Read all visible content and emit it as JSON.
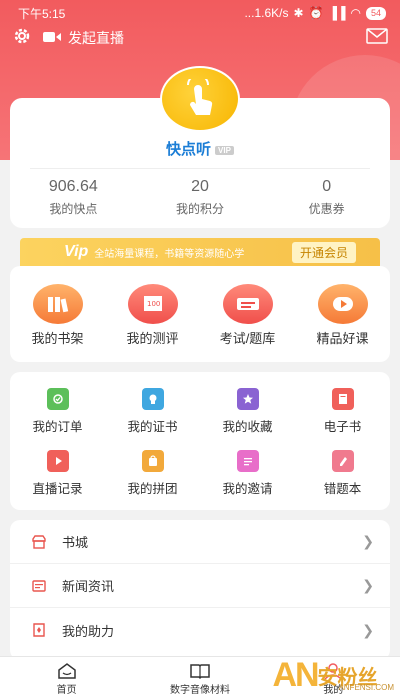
{
  "status_bar": {
    "time": "下午5:15",
    "network": "...1.6K/s",
    "battery": "54"
  },
  "top_bar": {
    "live_label": "发起直播"
  },
  "profile": {
    "username": "快点听",
    "vip_badge": "VIP",
    "stats": [
      {
        "value": "906.64",
        "label": "我的快点"
      },
      {
        "value": "20",
        "label": "我的积分"
      },
      {
        "value": "0",
        "label": "优惠券"
      }
    ]
  },
  "vip_banner": {
    "vip_word": "Vip",
    "description": "全站海量课程，书籍等资源随心学",
    "button": "开通会员"
  },
  "main_grid": [
    {
      "label": "我的书架",
      "icon": "bookshelf-icon"
    },
    {
      "label": "我的测评",
      "icon": "assessment-icon"
    },
    {
      "label": "考试/题库",
      "icon": "exam-icon"
    },
    {
      "label": "精品好课",
      "icon": "play-course-icon"
    }
  ],
  "sub_grid": [
    {
      "label": "我的订单",
      "icon": "order-icon",
      "color": "#5cbf5a"
    },
    {
      "label": "我的证书",
      "icon": "certificate-icon",
      "color": "#3fa7e0"
    },
    {
      "label": "我的收藏",
      "icon": "star-icon",
      "color": "#8a63d2"
    },
    {
      "label": "电子书",
      "icon": "ebook-icon",
      "color": "#f0605a"
    },
    {
      "label": "直播记录",
      "icon": "live-record-icon",
      "color": "#f0605a"
    },
    {
      "label": "我的拼团",
      "icon": "group-buy-icon",
      "color": "#f2a93b"
    },
    {
      "label": "我的邀请",
      "icon": "invite-icon",
      "color": "#e86ec9"
    },
    {
      "label": "错题本",
      "icon": "mistake-book-icon",
      "color": "#f07a8e"
    }
  ],
  "list": [
    {
      "label": "书城",
      "icon": "store-icon"
    },
    {
      "label": "新闻资讯",
      "icon": "news-icon"
    },
    {
      "label": "我的助力",
      "icon": "boost-icon"
    }
  ],
  "bottom_nav": [
    {
      "label": "首页",
      "icon": "home-icon"
    },
    {
      "label": "数字音像材料",
      "icon": "media-book-icon"
    },
    {
      "label": "我的",
      "icon": "profile-icon"
    }
  ],
  "watermark": {
    "brand": "AN",
    "text": "安粉丝",
    "sub": "ANFENSI.COM"
  },
  "colors": {
    "header": "#f25b5e",
    "accent_blue": "#1c7ed6",
    "vip_gold": "#f6c048"
  }
}
